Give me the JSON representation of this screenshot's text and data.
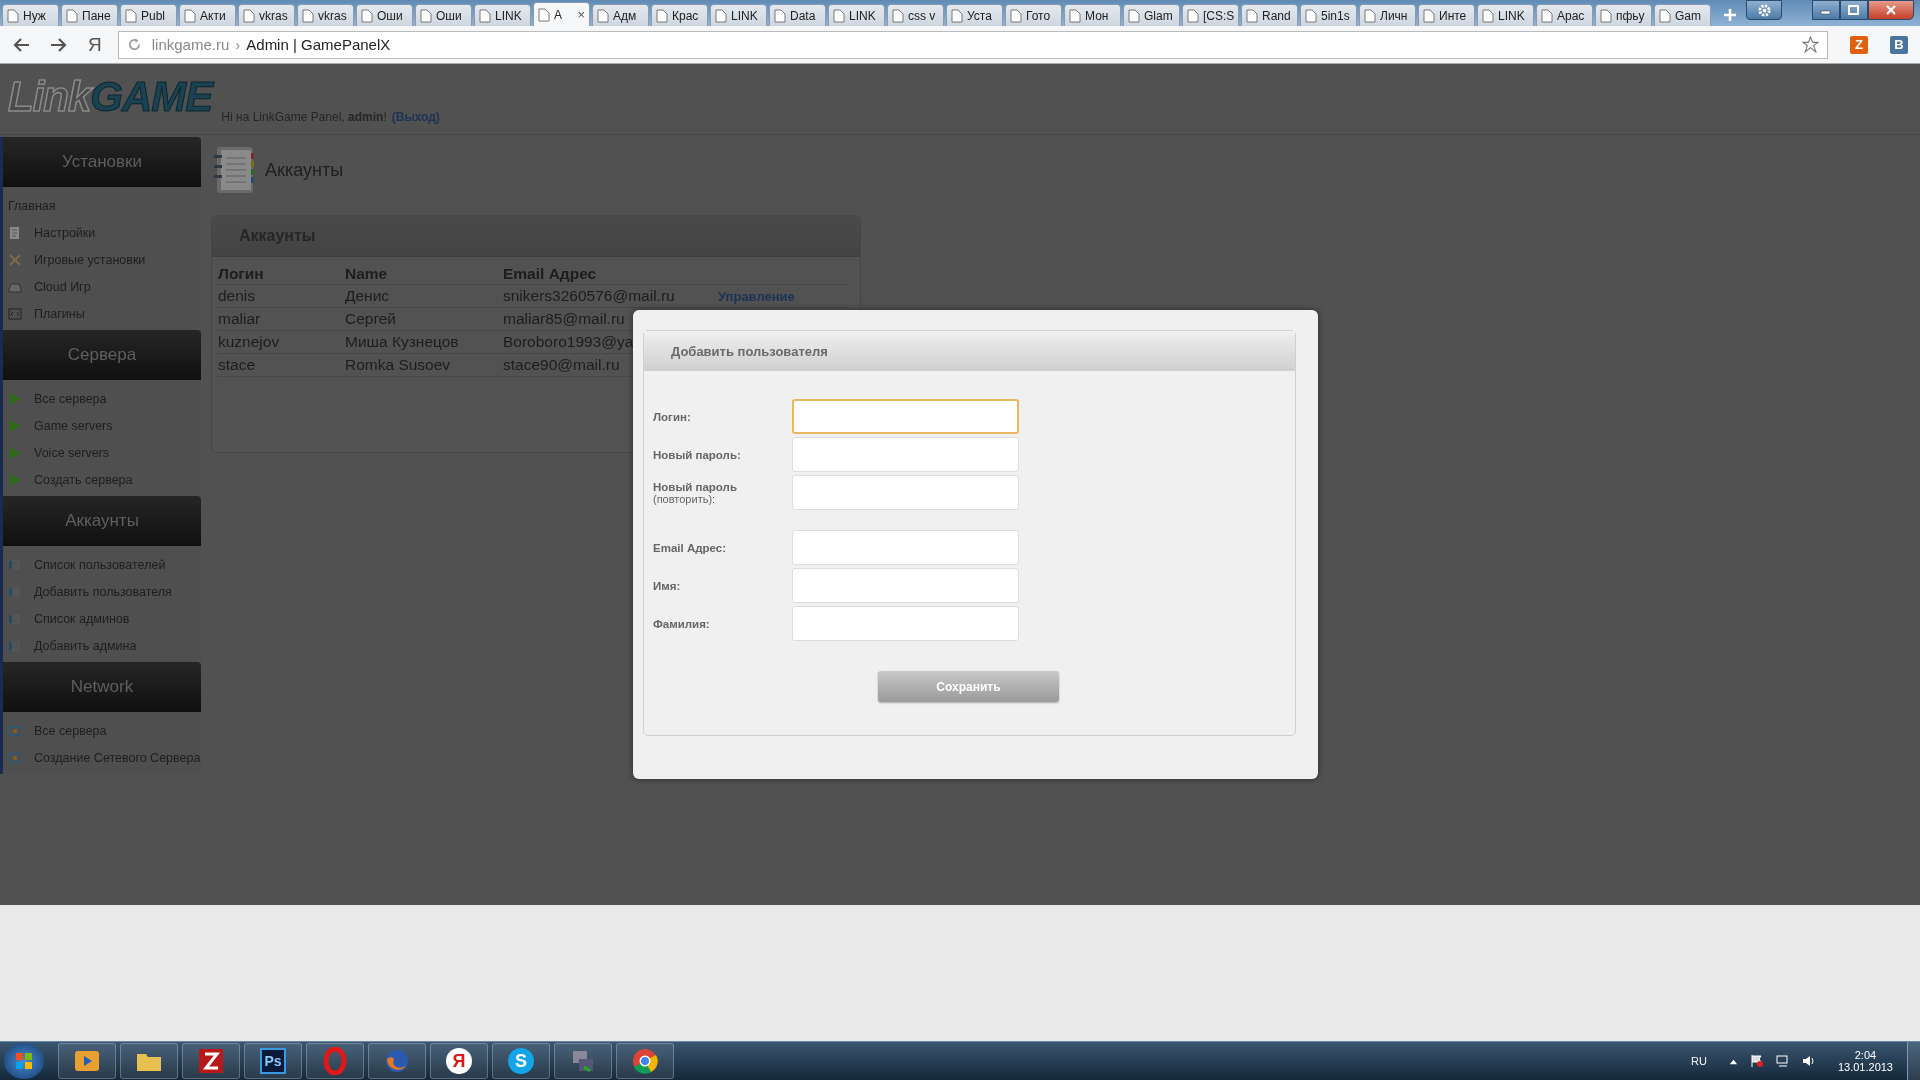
{
  "browser": {
    "tabs": [
      {
        "label": "Нуж",
        "selected": false
      },
      {
        "label": "Пане",
        "selected": false
      },
      {
        "label": "Publ",
        "selected": false
      },
      {
        "label": "Акти",
        "selected": false
      },
      {
        "label": "vkras",
        "selected": false
      },
      {
        "label": "vkras",
        "selected": false
      },
      {
        "label": "Оши",
        "selected": false
      },
      {
        "label": "Оши",
        "selected": false
      },
      {
        "label": "LINK",
        "selected": false
      },
      {
        "label": "A",
        "selected": true
      },
      {
        "label": "Адм",
        "selected": false
      },
      {
        "label": "Крас",
        "selected": false
      },
      {
        "label": "LINK",
        "selected": false
      },
      {
        "label": "Data",
        "selected": false
      },
      {
        "label": "LINK",
        "selected": false
      },
      {
        "label": "css v",
        "selected": false
      },
      {
        "label": "Уста",
        "selected": false
      },
      {
        "label": "Гото",
        "selected": false
      },
      {
        "label": "Мон",
        "selected": false
      },
      {
        "label": "Glam",
        "selected": false
      },
      {
        "label": "[CS:S",
        "selected": false
      },
      {
        "label": "Rand",
        "selected": false
      },
      {
        "label": "5in1s",
        "selected": false
      },
      {
        "label": "Личн",
        "selected": false
      },
      {
        "label": "Инте",
        "selected": false
      },
      {
        "label": "LINK",
        "selected": false
      },
      {
        "label": "Арас",
        "selected": false
      },
      {
        "label": "пфьу",
        "selected": false
      },
      {
        "label": "Gam",
        "selected": false
      }
    ],
    "close_tab": "×",
    "yandex_button": "Я",
    "address": {
      "domain": "linkgame.ru",
      "separator": "›",
      "title": "Admin | GamePanelX"
    },
    "extensions": [
      "Z",
      "B"
    ]
  },
  "header": {
    "logo": {
      "part_1": "Link",
      "part_2": "GAME"
    },
    "greeting": "Hi на LinkGame Panel, **admin**!",
    "logout": "(Выход)"
  },
  "sidebar": [
    {
      "title": "Установки",
      "items": [
        {
          "label": "Главная",
          "kind": "plain"
        },
        {
          "label": "Настройки",
          "kind": "doc"
        },
        {
          "label": "Игровые установки",
          "kind": "tools"
        },
        {
          "label": "Cloud Игр",
          "kind": "cloud"
        },
        {
          "label": "Плагины",
          "kind": "code"
        }
      ]
    },
    {
      "title": "Сервера",
      "items": [
        {
          "label": "Все сервера",
          "kind": "play"
        },
        {
          "label": "Game servers",
          "kind": "play"
        },
        {
          "label": "Voice servers",
          "kind": "play"
        },
        {
          "label": "Создать сервера",
          "kind": "play"
        }
      ]
    },
    {
      "title": "Аккаунты",
      "items": [
        {
          "label": "Список пользователей",
          "kind": "book"
        },
        {
          "label": "Добавить пользователя",
          "kind": "book"
        },
        {
          "label": "Список админов",
          "kind": "book"
        },
        {
          "label": "Добавить админа",
          "kind": "book"
        }
      ]
    },
    {
      "title": "Network",
      "items": [
        {
          "label": "Все сервера",
          "kind": "grid"
        },
        {
          "label": "Создание Сетевого Сервера",
          "kind": "grid"
        }
      ]
    }
  ],
  "page_title": "Аккаунты",
  "accounts_panel": {
    "title": "Аккаунты",
    "columns": [
      "Логин",
      "Name",
      "Email Адрес"
    ],
    "rows": [
      {
        "login": "denis",
        "name": "Денис",
        "email": "snikers3260576@mail.ru",
        "action": "Управление"
      },
      {
        "login": "maliar",
        "name": "Сергей",
        "email": "maliar85@mail.ru"
      },
      {
        "login": "kuznejov",
        "name": "Миша Кузнецов",
        "email": "Boroboro1993@ya"
      },
      {
        "login": "stace",
        "name": "Romka Susoev",
        "email": "stace90@mail.ru"
      }
    ]
  },
  "dialog": {
    "title": "Добавить пользователя",
    "groups": [
      [
        {
          "label": "Логин:",
          "focused": true
        },
        {
          "label": "Новый пароль:",
          "focused": false
        },
        {
          "label": "Новый пароль",
          "sublabel": "(повторить):",
          "focused": false
        }
      ],
      [
        {
          "label": "Email Адрес:",
          "focused": false
        },
        {
          "label": "Имя:",
          "focused": false
        },
        {
          "label": "Фамилия:",
          "focused": false
        }
      ]
    ],
    "save_button": "Сохранить"
  },
  "taskbar": {
    "apps": [
      {
        "kind": "media"
      },
      {
        "kind": "folder"
      },
      {
        "kind": "filezilla"
      },
      {
        "kind": "photoshop",
        "label": "Ps"
      },
      {
        "kind": "opera"
      },
      {
        "kind": "firefox"
      },
      {
        "kind": "yandex",
        "label": "Я"
      },
      {
        "kind": "skype",
        "label": "S"
      },
      {
        "kind": "network"
      },
      {
        "kind": "chrome"
      }
    ],
    "language": "RU",
    "time": "2:04",
    "date": "13.01.2013"
  }
}
